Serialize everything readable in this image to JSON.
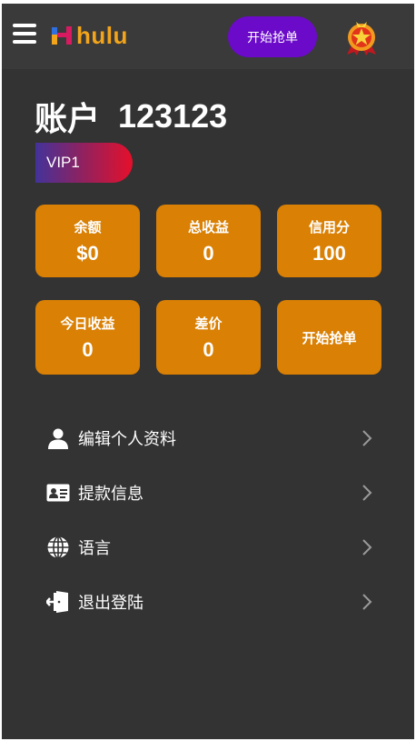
{
  "header": {
    "logo_text": "hulu",
    "grab_button_label": "开始抢单"
  },
  "account": {
    "title_label": "账户",
    "number": "123123",
    "vip_level": "VIP1"
  },
  "stats": [
    {
      "label": "余额",
      "value": "$0"
    },
    {
      "label": "总收益",
      "value": "0"
    },
    {
      "label": "信用分",
      "value": "100"
    },
    {
      "label": "今日收益",
      "value": "0"
    },
    {
      "label": "差价",
      "value": "0"
    }
  ],
  "action_card": {
    "label": "开始抢单"
  },
  "menu": [
    {
      "label": "编辑个人资料",
      "icon": "user-icon"
    },
    {
      "label": "提款信息",
      "icon": "id-card-icon"
    },
    {
      "label": "语言",
      "icon": "globe-icon"
    },
    {
      "label": "退出登陆",
      "icon": "logout-icon"
    }
  ],
  "colors": {
    "background": "#333333",
    "topbar": "#3a3a3a",
    "card": "#d98005",
    "grab_button": "#6b0ac9",
    "logo_text": "#f2a41a",
    "vip_gradient_start": "#43339a",
    "vip_gradient_end": "#e5102b"
  }
}
